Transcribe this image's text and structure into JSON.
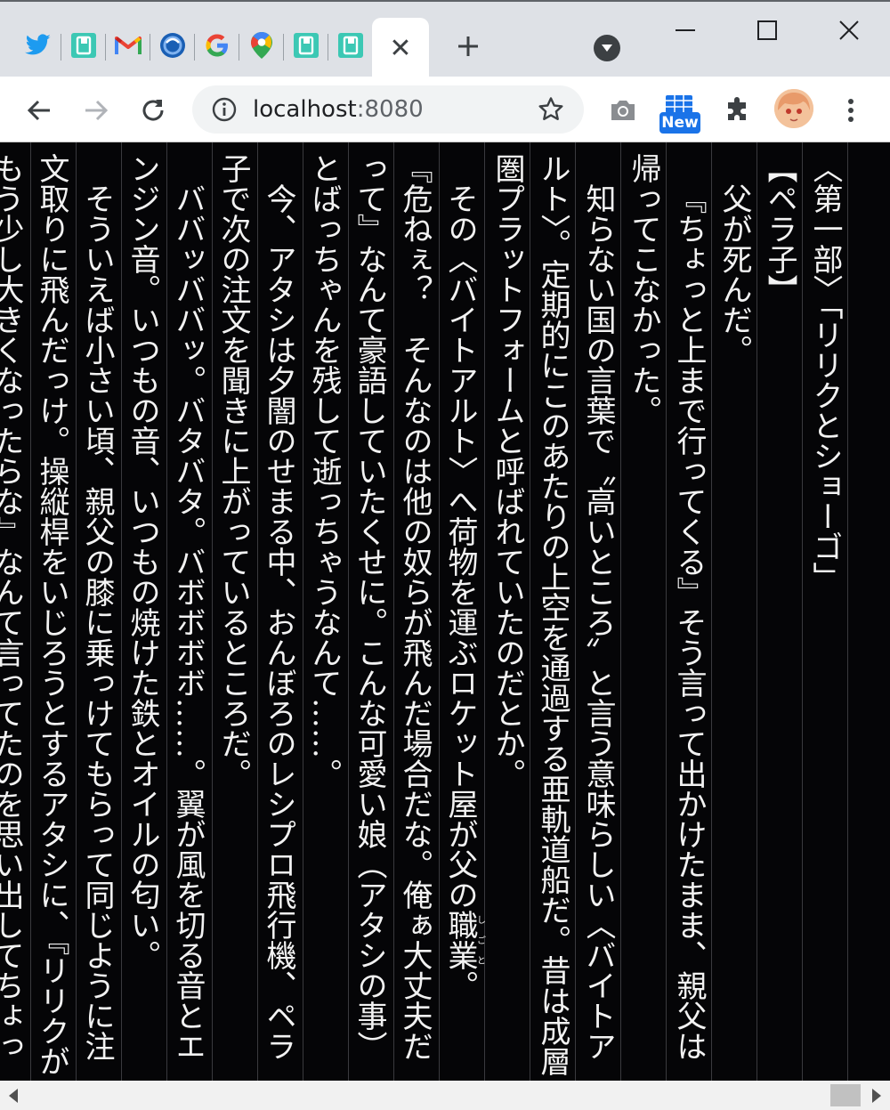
{
  "tabs": {
    "favicons": [
      "twitter-icon",
      "bookmark-app-icon",
      "gmail-icon",
      "firefox-browser-icon",
      "google-icon",
      "google-maps-icon",
      "bookmark-app-icon",
      "bookmark-app-icon"
    ],
    "active_close": "✕",
    "new_tab": "+"
  },
  "toolbar": {
    "url_host": "localhost",
    "url_port": ":8080",
    "new_badge": "New"
  },
  "colors": {
    "tabstrip": "#dee1e6",
    "page_bg": "#050507",
    "text": "#f2f2f2",
    "rule": "#3a3a3e",
    "accent_badge": "#1a73e8"
  },
  "content": {
    "heading_part": "〈第一部〉「リリクとショーゴ」",
    "heading_name": "【ペラ子】",
    "p1": "父が死んだ。",
    "p2": "『ちょっと上まで行ってくる』そう言って出かけたまま、親父は帰ってこなかった。",
    "p3a": "知らない国の言葉で〝高いところ〟と言う意味らしい〈バイトアルト〉。定期的にこのあたりの上空を通過する亜軌道船だ。昔は成層圏プラットフォームと呼ばれていたのだとか。",
    "p4a": "その〈バイトアルト〉へ荷物を運ぶロケット屋が父の",
    "p4ruby_base": "職業",
    "p4ruby_rt": "しごと",
    "p4b": "。",
    "p5": "『危ねぇ？　そんなのは他の奴らが飛んだ場合だな。俺ぁ大丈夫だって』なんて豪語していたくせに。こんな可愛い娘（アタシの事）とばっちゃんを残して逝っちゃうなんて……。",
    "p6": "今、アタシは夕闇のせまる中、おんぼろのレシプロ飛行機、ペラ子で次の注文を聞きに上がっているところだ。",
    "p7": "ババッババッ。バタバタ。バボボボボ……。翼が風を切る音とエンジン音。いつもの音、いつもの焼けた鉄とオイルの匂い。",
    "p8": "そういえば小さい頃、親父の膝に乗っけてもらって同じように注文取りに飛んだっけ。操縦桿をいじろうとするアタシに、『リリクがもう少し大きくなったらな』なんて言ってたのを思い出してちょっと泣きそう"
  }
}
